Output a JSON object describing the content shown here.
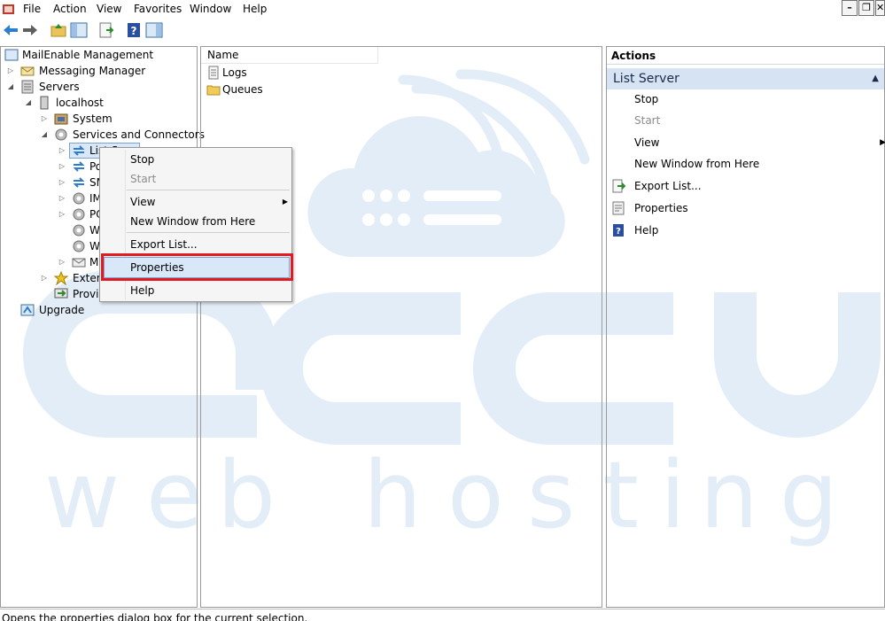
{
  "menubar": {
    "items": [
      "File",
      "Action",
      "View",
      "Favorites",
      "Window",
      "Help"
    ]
  },
  "tree": {
    "root": "MailEnable Management",
    "messaging": "Messaging Manager",
    "servers": "Servers",
    "localhost": "localhost",
    "system": "System",
    "services": "Services and Connectors",
    "children_visible": [
      "List Server",
      "Po",
      "SM",
      "IM",
      "PO",
      "W",
      "W",
      "M"
    ],
    "extensions": "Extens",
    "provisioning": "Provis",
    "upgrade": "Upgrade"
  },
  "list": {
    "column_name": "Name",
    "items": [
      "Logs",
      "Queues"
    ]
  },
  "actions": {
    "header": "Actions",
    "section": "List Server",
    "items": {
      "stop": "Stop",
      "start": "Start",
      "view": "View",
      "new_window": "New Window from Here",
      "export": "Export List...",
      "properties": "Properties",
      "help": "Help"
    }
  },
  "context_menu": {
    "stop": "Stop",
    "start": "Start",
    "view": "View",
    "new_window": "New Window from Here",
    "export": "Export List...",
    "properties": "Properties",
    "help": "Help"
  },
  "status": "Opens the properties dialog box for the current selection.",
  "colors": {
    "highlight": "#d9e8f8",
    "annotation": "#e01b24",
    "section_bg": "#d6e3f2",
    "watermark": "#e3edf7"
  }
}
